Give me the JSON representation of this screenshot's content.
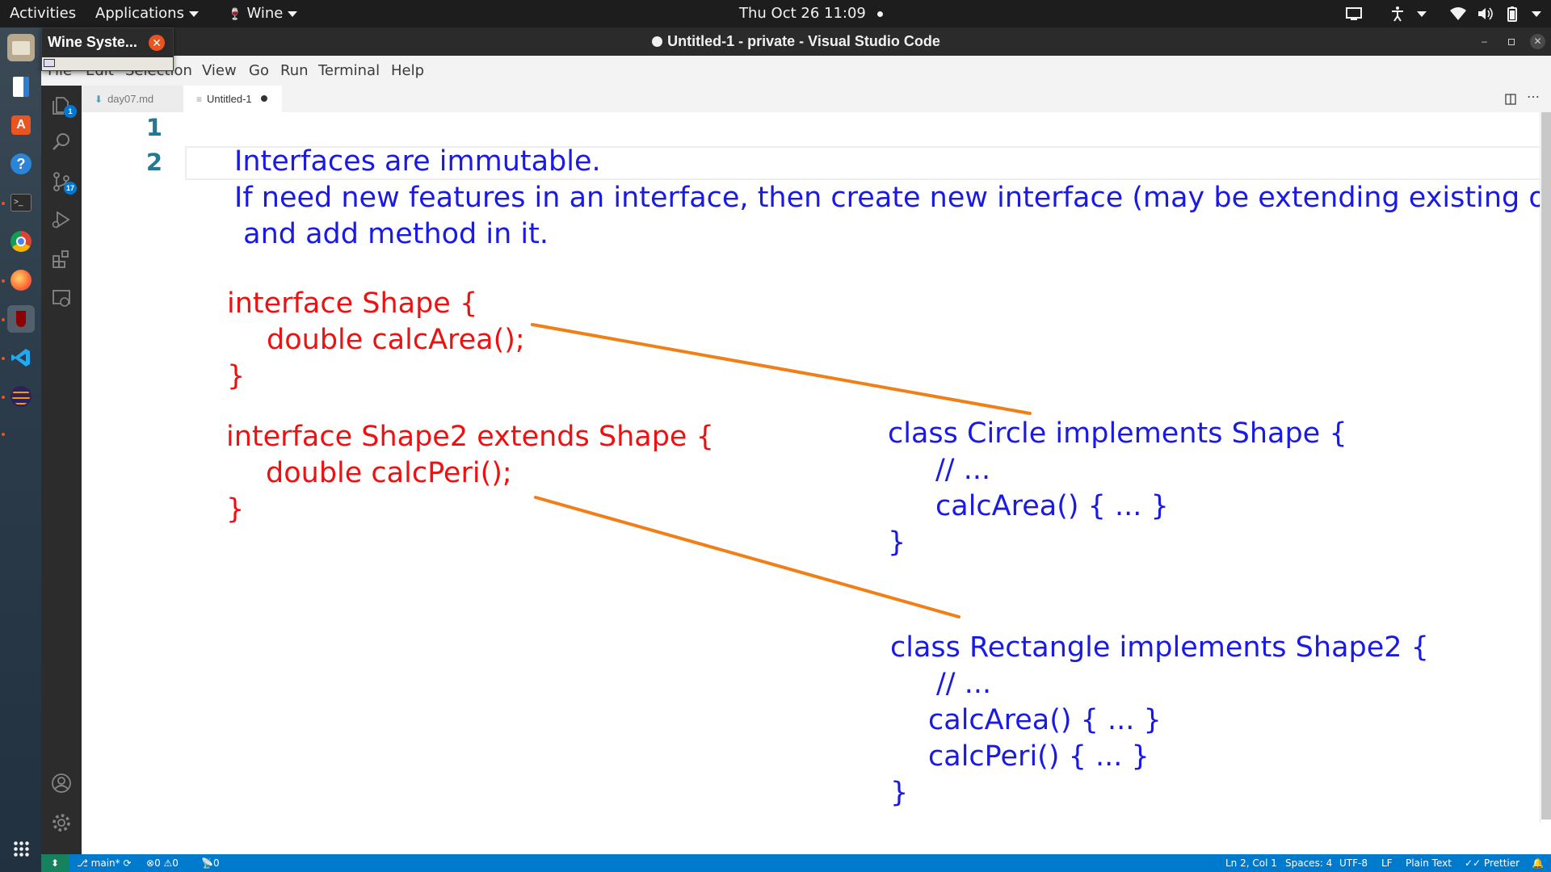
{
  "topbar": {
    "activities": "Activities",
    "applications": "Applications",
    "wine_app": "Wine",
    "clock": "Thu Oct 26  11:09"
  },
  "window": {
    "title": "Untitled-1 - private - Visual Studio Code"
  },
  "wine_popup": {
    "title": "Wine Syste..."
  },
  "menu": {
    "file": "File",
    "edit": "Edit",
    "selection": "Selection",
    "view": "View",
    "go": "Go",
    "run": "Run",
    "terminal": "Terminal",
    "help": "Help"
  },
  "activity_badges": {
    "explorer": "1",
    "source_control": "17"
  },
  "tabs": [
    {
      "label": "day07.md",
      "active": false
    },
    {
      "label": "Untitled-1",
      "active": true,
      "modified": true
    }
  ],
  "editor": {
    "line_numbers": [
      "1",
      "2"
    ],
    "lines": {
      "intro1": "Interfaces are immutable.",
      "intro2": "If need new features in an interface, then create new interface (may be extending existing one)",
      "intro3": " and add method in it.",
      "shape_decl": "interface Shape {",
      "shape_method": "double calcArea();",
      "shape_close": "}",
      "shape2_decl": "interface Shape2 extends Shape {",
      "shape2_method": "double calcPeri();",
      "shape2_close": "}",
      "circle_decl": "class Circle implements Shape {",
      "circle_comment": "// ...",
      "circle_method": "calcArea() { ... }",
      "circle_close": "}",
      "rect_decl": "class Rectangle implements Shape2 {",
      "rect_comment": "// ...",
      "rect_method1": "calcArea() { ... }",
      "rect_method2": "calcPeri() { ... }",
      "rect_close": "}"
    },
    "colors": {
      "blue_text": "#1a1ae6",
      "red_text": "#ee1111",
      "arrow": "#f07f17"
    }
  },
  "statusbar": {
    "branch": "main*",
    "errors": "0",
    "warnings": "0",
    "ports": "0",
    "position": "Ln 2, Col 1",
    "spaces": "Spaces: 4",
    "encoding": "UTF-8",
    "eol": "LF",
    "language": "Plain Text",
    "formatter": "Prettier"
  }
}
